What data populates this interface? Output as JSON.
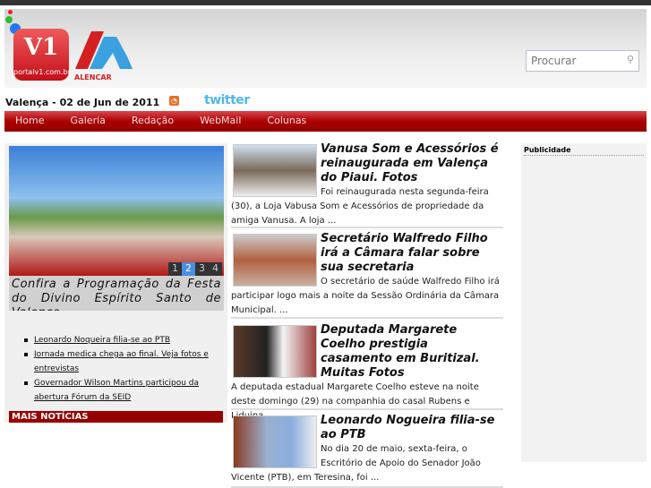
{
  "header": {
    "logo_text": "V1",
    "logo_sub": "portalv1.com.br",
    "partner_logo": "ALENCAR",
    "search_placeholder": "Procurar"
  },
  "date": "Valença - 02 de Jun de 2011",
  "twitter": "twitter",
  "nav": [
    "Home",
    "Galeria",
    "Redação",
    "WebMail",
    "Colunas"
  ],
  "slider": {
    "pages": [
      "1",
      "2",
      "3",
      "4"
    ],
    "active": 2,
    "caption": "Confira a Programação da Festa do Divino Espírito Santo de Valença"
  },
  "headlines": [
    "Leonardo Noqueira filia-se ao PTB",
    "Jornada medica chega ao final. Veja fotos e entrevistas",
    "Governador Wilson Martins participou da abertura Fórum da SEID"
  ],
  "mais": "MAIS NOTÍCIAS",
  "articles": [
    {
      "title": "Vanusa Som e Acessórios é reinaugurada em Valença do Piaui. Fotos",
      "body": "Foi reinaugurada nesta segunda-feira (30), a Loja Vabusa Som e Acessórios de propriedade da amiga Vanusa. A loja ..."
    },
    {
      "title": "Secretário Walfredo Filho irá a Câmara falar sobre sua secretaria",
      "body": "O secretário de saúde Walfredo Filho irá participar logo mais a noite da Sessão Ordinária da Câmara Municipal. ..."
    },
    {
      "title": "Deputada Margarete Coelho prestigia casamento em Buritizal. Muitas Fotos",
      "body": "A deputada estadual Margarete Coelho esteve na noite deste domingo (29) na companhia do casal Rubens e Liduina ..."
    },
    {
      "title": "Leonardo Nogueira filia-se ao PTB",
      "body": "No dia 20 de maio, sexta-feira, o Escritório de Apoio do Senador João Vicente (PTB), em Teresina, foi ..."
    }
  ],
  "sidebar": {
    "title": "Publicidade"
  }
}
